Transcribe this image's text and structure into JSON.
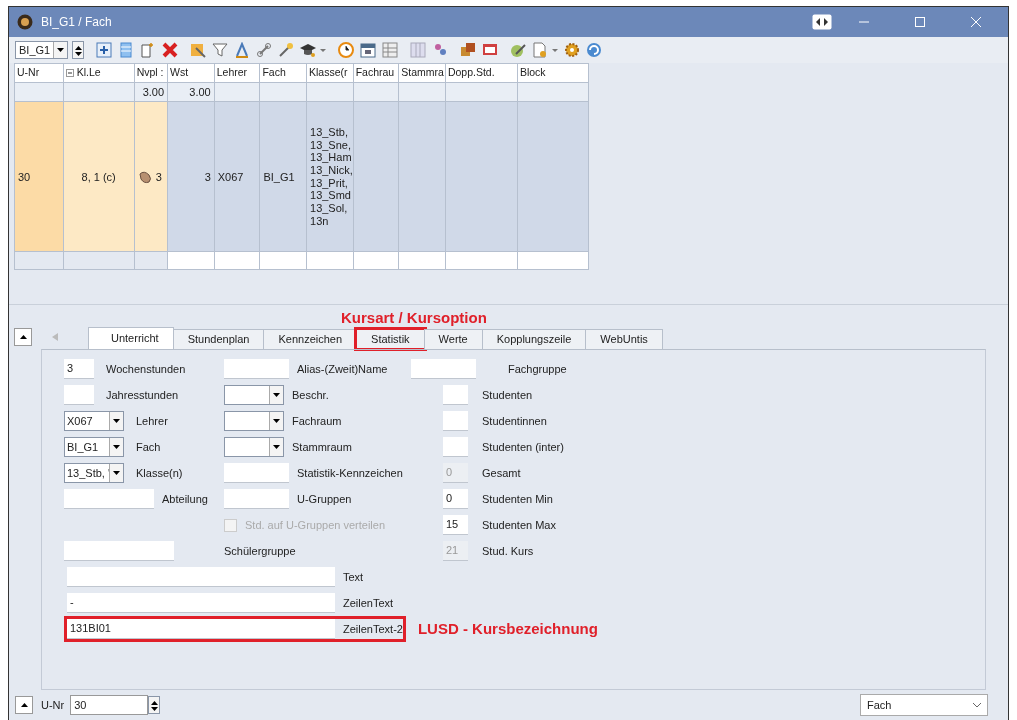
{
  "window": {
    "title": "BI_G1 / Fach"
  },
  "toolbar": {
    "selector": {
      "value": "BI_G1"
    }
  },
  "table": {
    "columns": [
      "U-Nr",
      "Kl.Le",
      "Nvpl :",
      "Wst",
      "Lehrer",
      "Fach",
      "Klasse(r",
      "Fachrau",
      "Stammra",
      "Dopp.Std.",
      "Block"
    ],
    "totals": {
      "nvpl": "3.00",
      "wst": "3.00"
    },
    "rows": [
      {
        "selected": true,
        "cells": [
          "30",
          "8, 1 (c)",
          "3",
          "3",
          "X067",
          "BI_G1",
          "13_Stb,\n13_Sne,\n13_Ham\n13_Nick,\n13_Prit,\n13_Smd\n13_Sol,\n13n",
          null,
          null,
          null,
          null
        ]
      }
    ]
  },
  "annotations": [
    {
      "kind": "tab",
      "text": "Kursart / Kursoption"
    },
    {
      "kind": "field",
      "text": "LUSD - Kursbezeichnung"
    }
  ],
  "tabs": [
    {
      "label": "Unterricht",
      "selected": true,
      "highlighted": false
    },
    {
      "label": "Stundenplan",
      "selected": false,
      "highlighted": false
    },
    {
      "label": "Kennzeichen",
      "selected": false,
      "highlighted": false
    },
    {
      "label": "Statistik",
      "selected": false,
      "highlighted": true
    },
    {
      "label": "Werte",
      "selected": false,
      "highlighted": false
    },
    {
      "label": "Kopplungszeile",
      "selected": false,
      "highlighted": false
    },
    {
      "label": "WebUntis",
      "selected": false,
      "highlighted": false
    }
  ],
  "form": {
    "column_1": [
      {
        "kind": "input",
        "value": "3",
        "label": "Wochenstunden"
      },
      {
        "kind": "input",
        "label": "Jahresstunden"
      },
      {
        "kind": "select",
        "value": "X067",
        "label": "Lehrer"
      },
      {
        "kind": "select",
        "value": "BI_G1",
        "label": "Fach"
      },
      {
        "kind": "select",
        "value": "13_Stb, '",
        "label": "Klasse(n)"
      },
      {
        "kind": "input",
        "label": "Abteilung"
      }
    ],
    "column_2": [
      {
        "kind": "input",
        "label": "Alias-(Zweit)Name"
      },
      {
        "kind": "select",
        "label": "Beschr."
      },
      {
        "kind": "select",
        "label": "Fachraum"
      },
      {
        "kind": "select",
        "label": "Stammraum"
      },
      {
        "kind": "input",
        "label": "Statistik-Kennzeichen"
      },
      {
        "kind": "input",
        "label": "U-Gruppen"
      },
      {
        "kind": "checkbox",
        "checked": false,
        "disabled": true,
        "label": "Std. auf U-Gruppen verteilen"
      }
    ],
    "column_3": [
      {
        "kind": "input",
        "label": "Fachgruppe",
        "disabled": false
      },
      {
        "kind": "input",
        "label": "Studenten",
        "disabled": false
      },
      {
        "kind": "input",
        "label": "Studentinnen",
        "disabled": false
      },
      {
        "kind": "input",
        "label": "Studenten (inter)",
        "disabled": false
      },
      {
        "kind": "input",
        "value": "0",
        "label": "Gesamt",
        "disabled": true
      },
      {
        "kind": "input",
        "value": "0",
        "label": "Studenten Min",
        "disabled": false
      },
      {
        "kind": "input",
        "value": "15",
        "label": "Studenten Max",
        "disabled": false
      },
      {
        "kind": "input",
        "value": "21",
        "label": "Stud. Kurs",
        "disabled": true
      }
    ],
    "group_field": {
      "label": "Schülergruppe"
    },
    "text_fields": [
      {
        "label": "Text",
        "highlighted": false
      },
      {
        "value": "-",
        "label": "ZeilenText",
        "highlighted": false
      },
      {
        "value": "131BI01",
        "label": "ZeilenText-2",
        "highlighted": true
      }
    ]
  },
  "footer": {
    "label": "U-Nr",
    "value": "30",
    "view": "Fach"
  }
}
